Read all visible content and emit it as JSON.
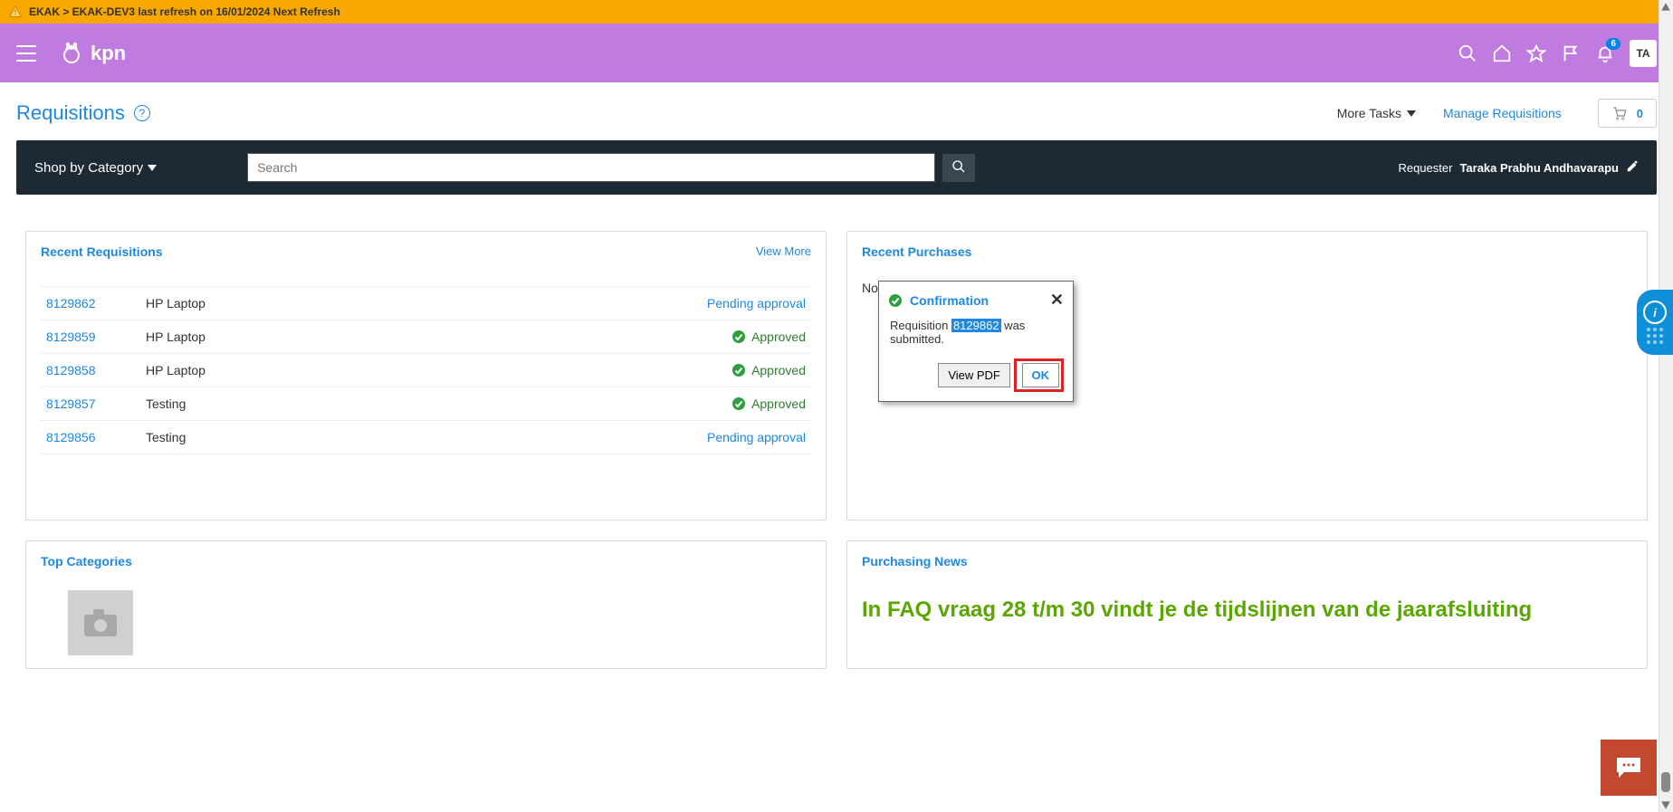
{
  "banner": {
    "text": "EKAK > EKAK-DEV3 last refresh on 16/01/2024 Next Refresh"
  },
  "brand": {
    "name": "kpn"
  },
  "topbar": {
    "notif_count": "6",
    "avatar": "TA"
  },
  "page": {
    "title": "Requisitions",
    "more_tasks": "More Tasks",
    "manage": "Manage Requisitions",
    "cart_count": "0"
  },
  "darkbar": {
    "shop_label": "Shop by Category",
    "search_placeholder": "Search",
    "requester_label": "Requester",
    "requester_name": "Taraka Prabhu Andhavarapu"
  },
  "recent_req": {
    "title": "Recent Requisitions",
    "view_more": "View More",
    "rows": [
      {
        "id": "8129862",
        "desc": "HP Laptop",
        "status": "Pending approval",
        "kind": "pending"
      },
      {
        "id": "8129859",
        "desc": "HP Laptop",
        "status": "Approved",
        "kind": "approved"
      },
      {
        "id": "8129858",
        "desc": "HP Laptop",
        "status": "Approved",
        "kind": "approved"
      },
      {
        "id": "8129857",
        "desc": "Testing",
        "status": "Approved",
        "kind": "approved"
      },
      {
        "id": "8129856",
        "desc": "Testing",
        "status": "Pending approval",
        "kind": "pending"
      }
    ]
  },
  "recent_pur": {
    "title": "Recent Purchases",
    "no_items": "No"
  },
  "dialog": {
    "title": "Confirmation",
    "prefix": "Requisition ",
    "req_id": "8129862",
    "suffix": " was submitted.",
    "view_pdf": "View PDF",
    "ok": "OK"
  },
  "top_cat": {
    "title": "Top Categories"
  },
  "news": {
    "title": "Purchasing News",
    "body": "In FAQ vraag 28 t/m 30 vindt je de tijdslijnen van de jaarafsluiting"
  }
}
